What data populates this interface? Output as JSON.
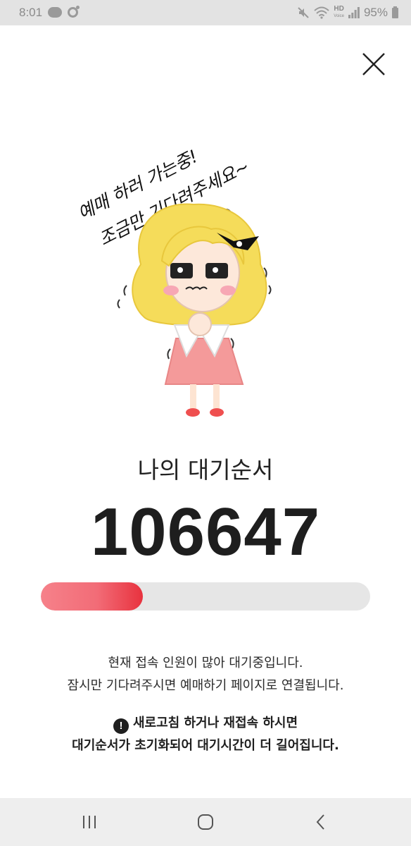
{
  "status_bar": {
    "time": "8:01",
    "hd_label": "HD",
    "voice_label": "Voice",
    "battery": "95%"
  },
  "handwritten_note": {
    "line1": "예매 하러 가는중!",
    "line2": "조금만 기다려주세요~"
  },
  "queue": {
    "label": "나의 대기순서",
    "number": "106647",
    "progress": 0.31
  },
  "message": {
    "line1": "현재 접속 인원이 많아 대기중입니다.",
    "line2": "잠시만 기다려주시면 예매하기 페이지로 연결됩니다."
  },
  "warning": {
    "icon_glyph": "!",
    "line1": "새로고침 하거나 재접속 하시면",
    "line2": "대기순서가 초기화되어 대기시간이 더 길어집니다."
  },
  "icons": {
    "close": "close-icon",
    "nav_recent": "recent-apps-icon",
    "nav_home": "home-icon",
    "nav_back": "back-icon"
  },
  "colors": {
    "progress_start": "#f6818a",
    "progress_end": "#e8323e",
    "progress_track": "#e6e6e6",
    "status_bar_bg": "#e3e3e3",
    "nav_bar_bg": "#eeeeee"
  }
}
